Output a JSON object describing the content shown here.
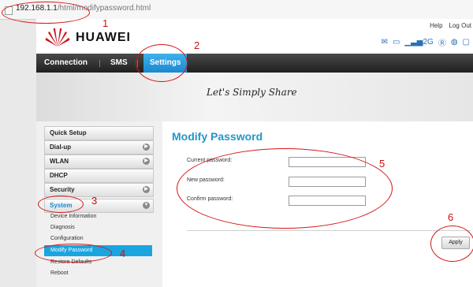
{
  "address_bar": {
    "host": "192.168.1.1",
    "path": "/html/modifypassword.html"
  },
  "header": {
    "brand": "HUAWEI",
    "links": [
      "Help",
      "Log Out"
    ],
    "signal": "2G"
  },
  "nav": {
    "items": [
      "Connection",
      "SMS",
      "Settings"
    ],
    "active": "Settings"
  },
  "banner": {
    "slogan": "Let's Simply Share"
  },
  "sidebar": {
    "items": [
      "Quick Setup",
      "Dial-up",
      "WLAN",
      "DHCP",
      "Security",
      "System"
    ],
    "system_sub": [
      "Device Information",
      "Diagnosis",
      "Configuration",
      "Modify Password",
      "Restore Defaults",
      "Reboot"
    ],
    "active_sub": "Modify Password"
  },
  "main": {
    "title": "Modify Password",
    "fields": [
      {
        "label": "Current password:",
        "value": ""
      },
      {
        "label": "New password:",
        "value": ""
      },
      {
        "label": "Confirm password:",
        "value": ""
      }
    ],
    "apply_label": "Apply"
  },
  "annotations": [
    "1",
    "2",
    "3",
    "4",
    "5",
    "6"
  ],
  "colors": {
    "accent": "#1a88cf",
    "annotation": "#d81414",
    "nav_bg": "#2a2a2a"
  }
}
